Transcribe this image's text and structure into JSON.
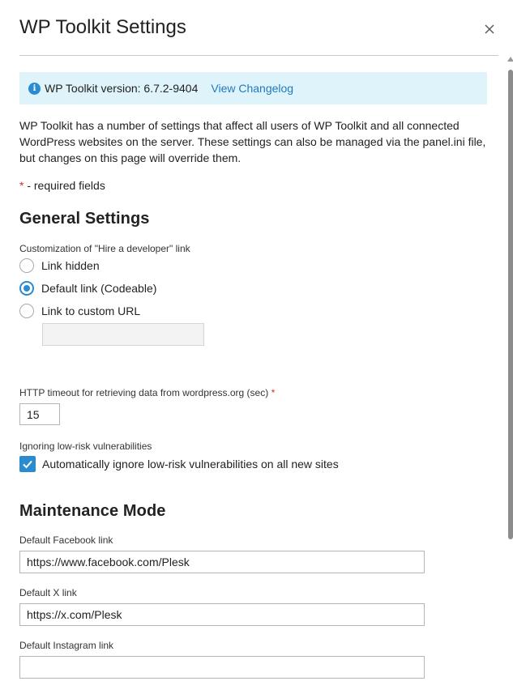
{
  "dialog": {
    "title": "WP Toolkit Settings"
  },
  "info": {
    "version_text": "WP Toolkit version: 6.7.2-9404",
    "changelog_link": "View Changelog"
  },
  "description": "WP Toolkit has a number of settings that affect all users of WP Toolkit and all connected WordPress websites on the server. These settings can also be managed via the panel.ini file, but changes on this page will override them.",
  "required_note": {
    "asterisk": "*",
    "text": " - required fields"
  },
  "general": {
    "heading": "General Settings",
    "hire_label": "Customization of \"Hire a developer\" link",
    "options": [
      {
        "label": "Link hidden",
        "checked": false
      },
      {
        "label": "Default link (Codeable)",
        "checked": true
      },
      {
        "label": "Link to custom URL",
        "checked": false
      }
    ],
    "custom_url_value": "",
    "timeout_label": "HTTP timeout for retrieving data from wordpress.org (sec)",
    "timeout_required": "*",
    "timeout_value": "15",
    "vuln_label": "Ignoring low-risk vulnerabilities",
    "vuln_checkbox_label": "Automatically ignore low-risk vulnerabilities on all new sites",
    "vuln_checked": true
  },
  "maintenance": {
    "heading": "Maintenance Mode",
    "facebook_label": "Default Facebook link",
    "facebook_value": "https://www.facebook.com/Plesk",
    "x_label": "Default X link",
    "x_value": "https://x.com/Plesk",
    "instagram_label": "Default Instagram link",
    "instagram_value": ""
  },
  "colors": {
    "accent": "#2a8bd1",
    "link": "#1e79c2",
    "info_bg": "#dff3fa",
    "required": "#d02e2e"
  }
}
